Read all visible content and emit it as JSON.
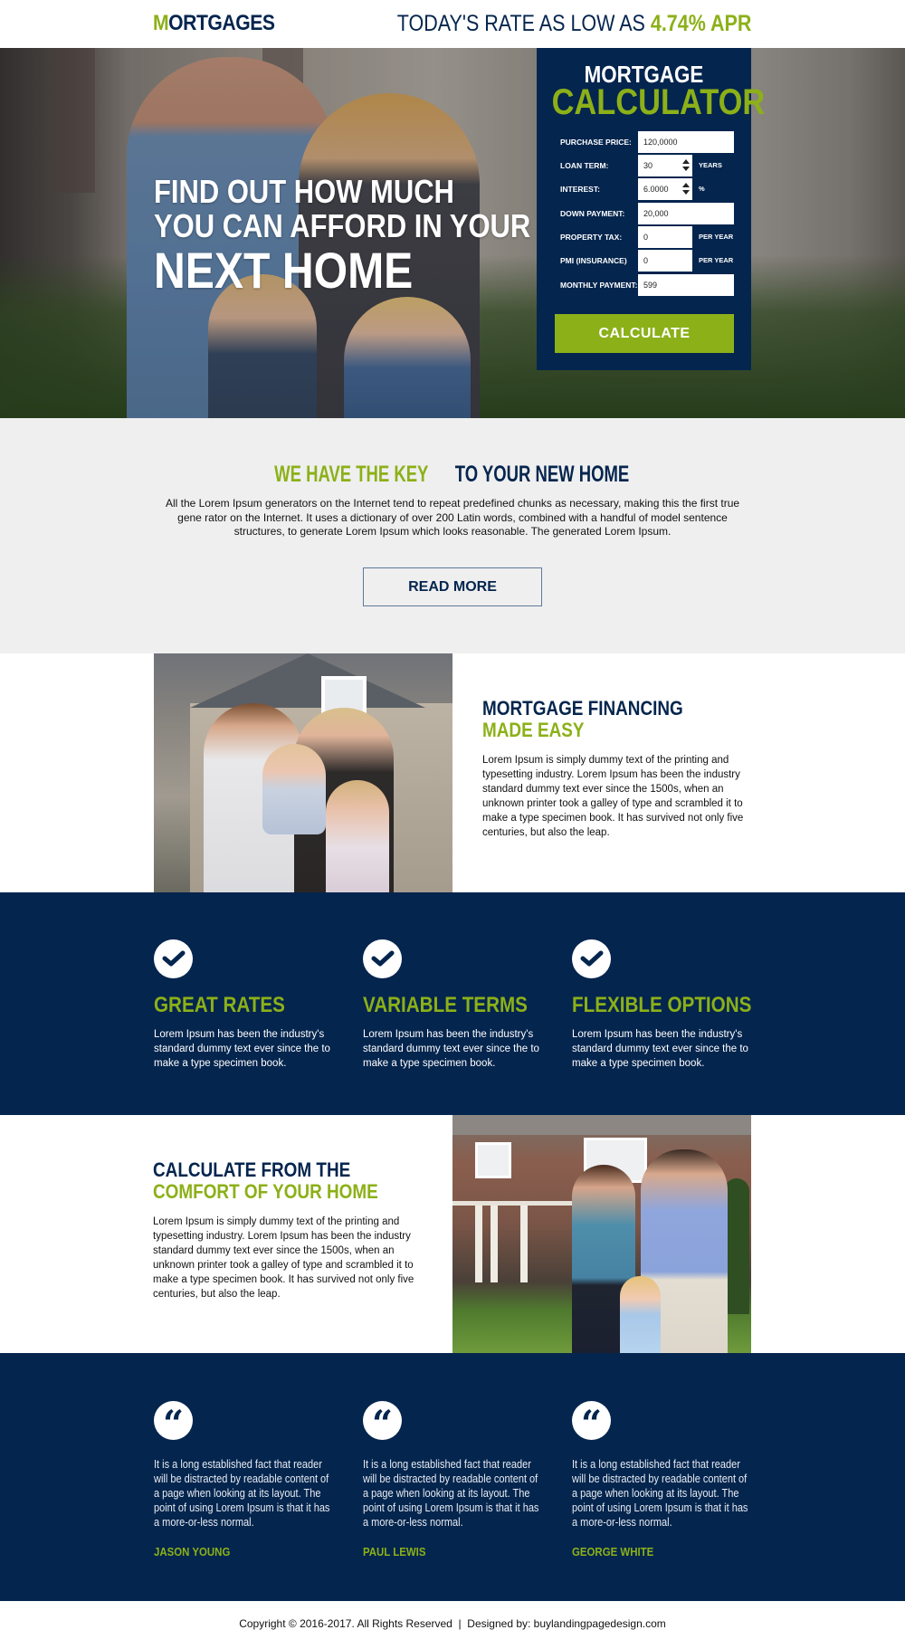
{
  "header": {
    "logo_first": "M",
    "logo_rest": "ORTGAGES",
    "rate_prefix": "TODAY'S RATE AS LOW AS ",
    "rate_value": "4.74% APR"
  },
  "hero": {
    "line1": "FIND OUT HOW MUCH",
    "line2": "YOU CAN AFFORD IN YOUR",
    "line3": "NEXT HOME"
  },
  "calculator": {
    "title_top": "MORTGAGE",
    "title_bottom": "CALCULATOR",
    "fields": [
      {
        "label": "PURCHASE PRICE:",
        "value": "120,0000",
        "unit": ""
      },
      {
        "label": "LOAN TERM:",
        "value": "30",
        "unit": "YEARS"
      },
      {
        "label": "INTEREST:",
        "value": "6.0000",
        "unit": "%"
      },
      {
        "label": "DOWN PAYMENT:",
        "value": "20,000",
        "unit": ""
      },
      {
        "label": "PROPERTY TAX:",
        "value": "0",
        "unit": "PER YEAR"
      },
      {
        "label": "PMI (INSURANCE)",
        "value": "0",
        "unit": "PER YEAR"
      },
      {
        "label": "MONTHLY PAYMENT:",
        "value": "599",
        "unit": ""
      }
    ],
    "button_label": "CALCULATE"
  },
  "key_section": {
    "title_green": "WE HAVE THE KEY",
    "title_navy": " TO YOUR NEW HOME",
    "body": "All the Lorem Ipsum generators on the Internet tend to repeat predefined chunks as necessary, making this the first true gene rator on the Internet. It uses a dictionary of over 200 Latin words, combined with a handful of model sentence structures, to generate Lorem Ipsum which looks reasonable. The generated Lorem Ipsum.",
    "button_label": "READ MORE"
  },
  "financing": {
    "title_navy": "MORTGAGE FINANCING",
    "title_green": "MADE EASY",
    "body": "Lorem Ipsum is simply dummy text of the printing and typesetting industry. Lorem Ipsum has been the industry standard dummy text ever since the 1500s, when an unknown printer took a galley of type and scrambled it to make a type specimen book. It has survived not only five centuries, but also the leap."
  },
  "features": [
    {
      "icon": "check-circle-icon",
      "title": "GREAT RATES",
      "body": "Lorem Ipsum has been the industry's standard dummy text ever since the to make a type specimen book."
    },
    {
      "icon": "check-circle-icon",
      "title": "VARIABLE TERMS",
      "body": "Lorem Ipsum has been the industry's standard dummy text ever since the to make a type specimen book."
    },
    {
      "icon": "check-circle-icon",
      "title": "FLEXIBLE OPTIONS",
      "body": "Lorem Ipsum has been the industry's standard dummy text ever since the to make a type specimen book."
    }
  ],
  "comfort": {
    "title_navy": "CALCULATE FROM THE",
    "title_green": "COMFORT OF YOUR HOME",
    "body": "Lorem Ipsum is simply dummy text of the printing and typesetting industry. Lorem Ipsum has been the industry standard dummy text ever since the 1500s, when an unknown printer took a galley of type and scrambled it to make a type specimen book. It has survived not only five centuries, but also the leap."
  },
  "testimonials": [
    {
      "icon_glyph": "“",
      "quote": "It is a long established fact that  reader will be distracted by readable content of a page when looking at its layout. The point of using Lorem Ipsum is that it has a more-or-less normal.",
      "name": "JASON YOUNG"
    },
    {
      "icon_glyph": "“",
      "quote": "It is a long established fact that  reader will be distracted by readable content of a page when looking at its layout. The point of using Lorem Ipsum is that it has a more-or-less normal.",
      "name": "PAUL LEWIS"
    },
    {
      "icon_glyph": "“",
      "quote": "It is a long established fact that  reader will be distracted by readable content of a page when looking at its layout. The point of using Lorem Ipsum is that it has a more-or-less normal.",
      "name": "GEORGE WHITE"
    }
  ],
  "footer": {
    "text": "Copyright © 2016-2017. All Rights Reserved  |  Designed by: buylandingpagedesign.com"
  },
  "colors": {
    "navy": "#04254e",
    "green": "#8cb018",
    "light_gray": "#efefef"
  }
}
